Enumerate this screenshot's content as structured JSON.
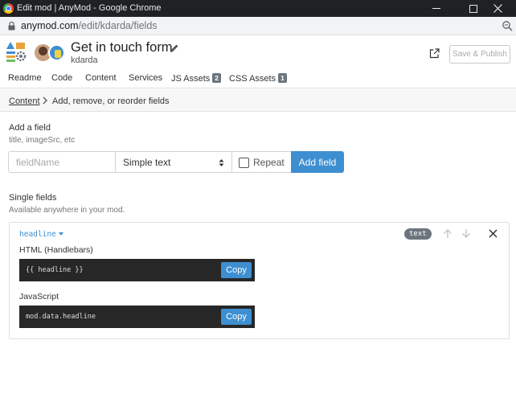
{
  "window": {
    "title": "Edit mod | AnyMod - Google Chrome"
  },
  "address_bar": {
    "domain": "anymod.com",
    "path": "/edit/kdarda/fields"
  },
  "header": {
    "mod_title": "Get in touch form",
    "owner": "kdarda",
    "publish_label": "Save & Publish"
  },
  "tabs": [
    {
      "label": "Readme"
    },
    {
      "label": "Code"
    },
    {
      "label": "Content"
    },
    {
      "label": "Services"
    },
    {
      "label": "JS Assets",
      "badge": "2"
    },
    {
      "label": "CSS Assets",
      "badge": "1"
    }
  ],
  "breadcrumb": {
    "parent": "Content",
    "current": "Add, remove, or reorder fields"
  },
  "add_field": {
    "title": "Add a field",
    "subtitle": "title, imageSrc, etc",
    "name_placeholder": "fieldName",
    "type_value": "Simple text",
    "repeat_label": "Repeat",
    "repeat_checked": false,
    "add_label": "Add field"
  },
  "single_fields": {
    "title": "Single fields",
    "subtitle": "Available anywhere in your mod.",
    "fields": [
      {
        "name": "headline",
        "type": "text",
        "html_label": "HTML (Handlebars)",
        "html_code": "{{ headline }}",
        "js_label": "JavaScript",
        "js_code": "mod.data.headline",
        "copy_label": "Copy"
      }
    ]
  },
  "colors": {
    "accent": "#3d8fd1",
    "code_bg": "#272727",
    "badge_bg": "#6c757d",
    "titlebar_bg": "#202124"
  }
}
